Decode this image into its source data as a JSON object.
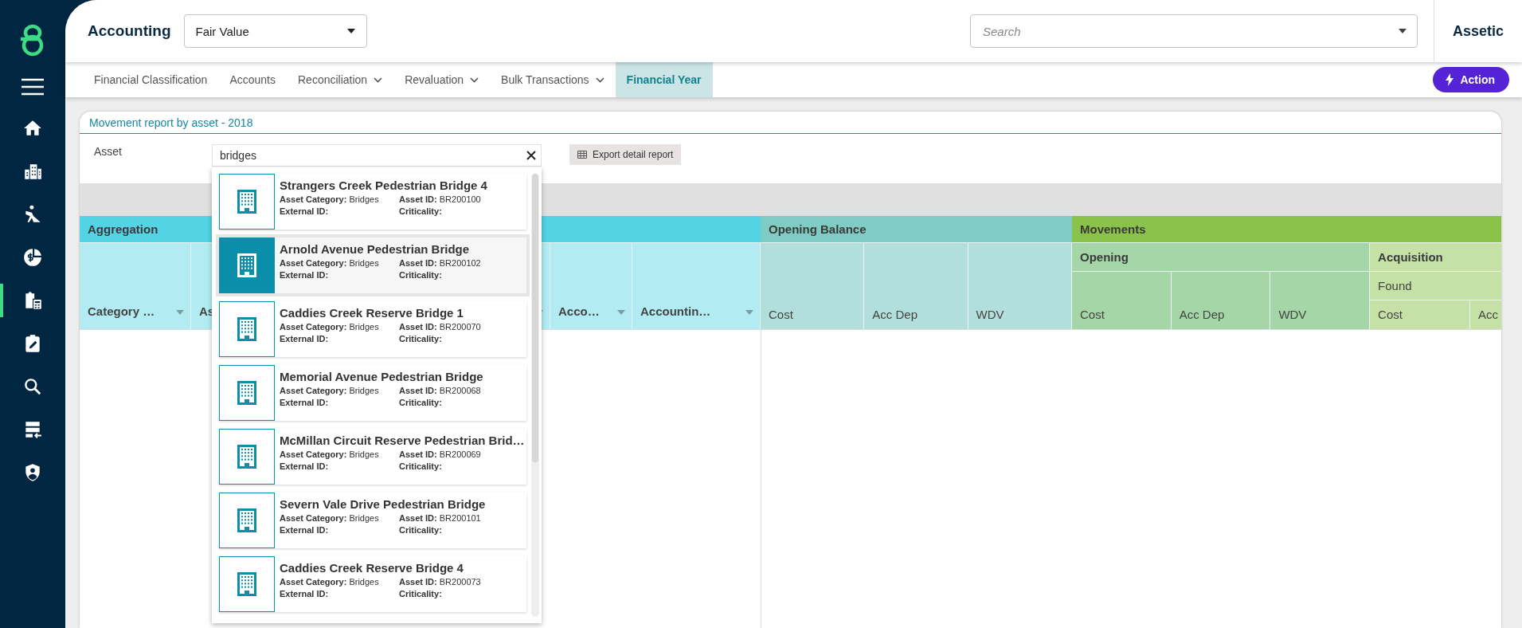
{
  "sidebar": {
    "items": [
      {
        "kind": "home",
        "selected": false
      },
      {
        "kind": "buildings",
        "selected": false
      },
      {
        "kind": "worker",
        "selected": false
      },
      {
        "kind": "finance",
        "selected": false
      },
      {
        "kind": "clipboard-calculator",
        "selected": true
      },
      {
        "kind": "clipboard-edit",
        "selected": false
      },
      {
        "kind": "search",
        "selected": false
      },
      {
        "kind": "server-import",
        "selected": false
      },
      {
        "kind": "shield-user",
        "selected": false
      }
    ]
  },
  "header": {
    "title": "Accounting",
    "module_select": "Fair Value",
    "search": {
      "placeholder": "Search"
    },
    "brand": "Assetic"
  },
  "tabs": [
    {
      "label": "Financial Classification",
      "dropdown": false,
      "selected": false
    },
    {
      "label": "Accounts",
      "dropdown": false,
      "selected": false
    },
    {
      "label": "Reconciliation",
      "dropdown": true,
      "selected": false
    },
    {
      "label": "Revaluation",
      "dropdown": true,
      "selected": false
    },
    {
      "label": "Bulk Transactions",
      "dropdown": true,
      "selected": false
    },
    {
      "label": "Financial Year",
      "dropdown": false,
      "selected": true
    }
  ],
  "action_button": "Action",
  "report": {
    "title": "Movement report by asset - 2018",
    "asset_label": "Asset",
    "asset_value": "bridges",
    "export_button": "Export detail report",
    "asset_results": [
      {
        "name": "Strangers Creek Pedestrian Bridge 4",
        "category": "**Asset Category:** Bridges",
        "asset_id": "**Asset ID:** BR200100",
        "external_id": "External ID:",
        "criticality": "Criticality:",
        "selected": false
      },
      {
        "name": "Arnold Avenue Pedestrian Bridge",
        "category": "**Asset Category:** Bridges",
        "asset_id": "**Asset ID:** BR200102",
        "external_id": "External ID:",
        "criticality": "Criticality:",
        "selected": true
      },
      {
        "name": "Caddies Creek Reserve Bridge 1",
        "category": "**Asset Category:** Bridges",
        "asset_id": "**Asset ID:** BR200070",
        "external_id": "External ID:",
        "criticality": "Criticality:",
        "selected": false
      },
      {
        "name": "Memorial Avenue Pedestrian Bridge",
        "category": "**Asset Category:** Bridges",
        "asset_id": "**Asset ID:** BR200068",
        "external_id": "External ID:",
        "criticality": "Criticality:",
        "selected": false
      },
      {
        "name": "McMillan Circuit Reserve Pedestrian Brid…",
        "category": "**Asset Category:** Bridges",
        "asset_id": "**Asset ID:** BR200069",
        "external_id": "External ID:",
        "criticality": "Criticality:",
        "selected": false
      },
      {
        "name": "Severn Vale Drive Pedestrian Bridge",
        "category": "**Asset Category:** Bridges",
        "asset_id": "**Asset ID:** BR200101",
        "external_id": "External ID:",
        "criticality": "Criticality:",
        "selected": false
      },
      {
        "name": "Caddies Creek Reserve Bridge 4",
        "category": "**Asset Category:** Bridges",
        "asset_id": "**Asset ID:** BR200073",
        "external_id": "External ID:",
        "criticality": "Criticality:",
        "selected": false
      }
    ],
    "table": {
      "aggregation": {
        "label": "Aggregation",
        "columns": [
          {
            "label": "Category …"
          },
          {
            "label": "As"
          },
          {},
          {},
          {
            "label": "Acco…"
          },
          {
            "label": "Accountin…"
          }
        ]
      },
      "opening_balance": {
        "label": "Opening Balance",
        "columns": [
          "Cost",
          "Acc Dep",
          "WDV"
        ]
      },
      "movements": {
        "label": "Movements",
        "groups": [
          {
            "label": "Opening",
            "columns": [
              "Cost",
              "Acc Dep",
              "WDV"
            ]
          },
          {
            "label": "Acquisition",
            "subgroup": "Found",
            "columns": [
              "Cost",
              "Acc"
            ]
          }
        ]
      }
    }
  }
}
